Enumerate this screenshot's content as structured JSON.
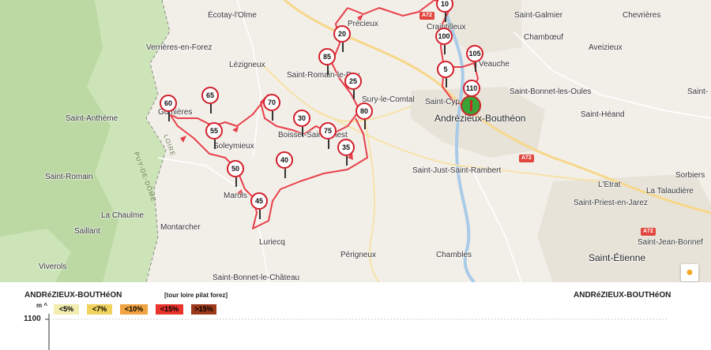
{
  "map": {
    "towns": {
      "ecotay": "Écotay-l'Olme",
      "pregieux": "Précieux",
      "craintilleux": "Craintilleux",
      "saint_galmier": "Saint-Galmier",
      "chevrieres": "Chevrières",
      "chambœuf": "Chambœuf",
      "aveizieux": "Aveizieux",
      "verrieres": "Verrières-en-Forez",
      "lezigneux": "Lézigneux",
      "saint_romain_le_puy": "Saint-Romain-le-Puy",
      "veauche": "Veauche",
      "sury": "Sury-le-Comtal",
      "saint_cyprien": "Saint-Cyp",
      "saint_bonnet_les_oules": "Saint-Bonnet-les-Oules",
      "saint_heand": "Saint-Héand",
      "saint_anthème": "Saint-Anthème",
      "gumieres": "Gumières",
      "soleymieux": "Soleymieux",
      "boisset": "Boisset-Saint-Priest",
      "andrezieux": "Andrézieux-Bouthéon",
      "saint_just": "Saint-Just-Saint-Rambert",
      "saint_romain": "Saint-Romain",
      "marols": "Marols",
      "letrat": "L'Etrat",
      "sorbiers": "Sorbiers",
      "la_talaudiere": "La Talaudière",
      "saint_priest": "Saint-Priest-en-Jarez",
      "la_chaulme": "La Chaulme",
      "saillant": "Saillant",
      "montarcher": "Montarcher",
      "saint_jean_bonnefonds": "Saint-Jean-Bonnef",
      "luriecq": "Luriecq",
      "perigneux": "Périgneux",
      "chambles": "Chambles",
      "saint_etienne": "Saint-Étienne",
      "viverols": "Viverols",
      "saint_bonnet_le_chateau": "Saint-Bonnet-le-Château",
      "saint_edge": "Saint-"
    },
    "regions": {
      "loire": "LOIRE",
      "puy_de_dome": "PUY-DE-DÔME"
    },
    "highways": [
      "A72",
      "A72",
      "A72"
    ],
    "km_markers": [
      "10",
      "100",
      "20",
      "85",
      "105",
      "5",
      "25",
      "110",
      "60",
      "65",
      "70",
      "30",
      "80",
      "55",
      "75",
      "35",
      "40",
      "50",
      "45"
    ]
  },
  "profile": {
    "start_label": "ANDRéZIEUX-BOUTHéON",
    "end_label": "ANDRéZIEUX-BOUTHéON",
    "tour_name": "[tour loire pilat forez]",
    "unit": "m",
    "y_top": "1100",
    "legend": [
      {
        "label": "<5%",
        "color": "#f3eeb0"
      },
      {
        "label": "<7%",
        "color": "#f0d25c"
      },
      {
        "label": "<10%",
        "color": "#f0a340"
      },
      {
        "label": "<15%",
        "color": "#e8342b"
      },
      {
        "label": ">15%",
        "color": "#9d3a1c"
      }
    ]
  }
}
